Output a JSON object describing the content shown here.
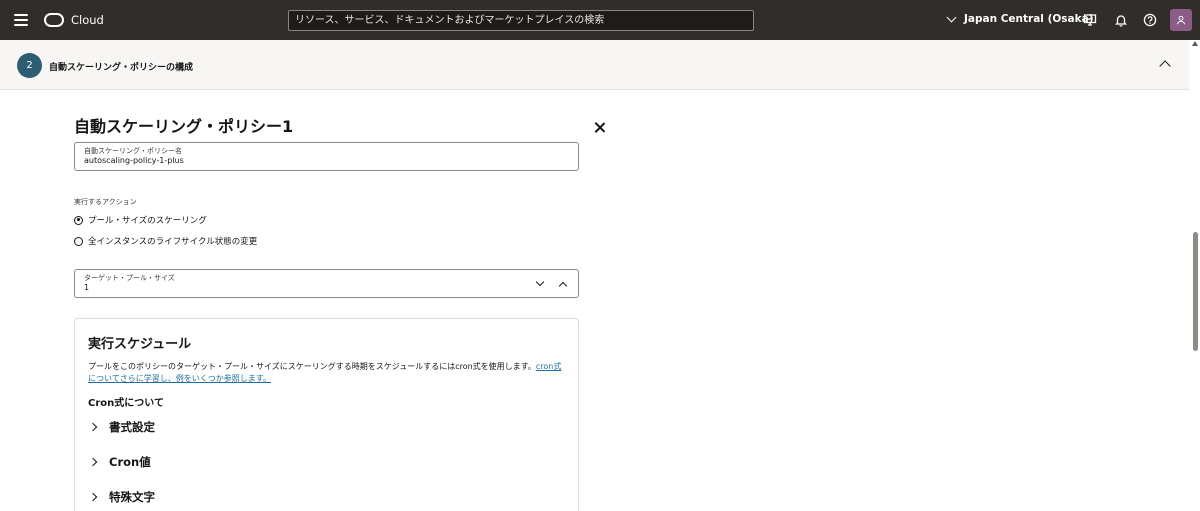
{
  "topbar": {
    "brand": "Cloud",
    "search_placeholder": "リソース、サービス、ドキュメントおよびマーケットプレイスの検索",
    "region": "Japan Central (Osaka)",
    "icons": [
      "menu-icon",
      "oracle-logo",
      "chevron-down-icon",
      "developer-tools-icon",
      "bell-icon",
      "help-icon",
      "user-icon"
    ]
  },
  "step": {
    "number": "2",
    "title": "自動スケーリング・ポリシーの構成"
  },
  "policy": {
    "title": "自動スケーリング・ポリシー1",
    "name_label": "自動スケーリング・ポリシー名",
    "name_value": "autoscaling-policy-1-plus",
    "action_label": "実行するアクション",
    "actions": [
      {
        "label": "プール・サイズのスケーリング",
        "selected": true
      },
      {
        "label": "全インスタンスのライフサイクル状態の変更",
        "selected": false
      }
    ],
    "target_label": "ターゲット・プール・サイズ",
    "target_value": "1"
  },
  "schedule": {
    "title": "実行スケジュール",
    "description": "プールをこのポリシーのターゲット・プール・サイズにスケーリングする時期をスケジュールするにはcron式を使用します。",
    "link": "cron式についてさらに学習し、例をいくつか参照します。",
    "cron_about": "Cron式について",
    "accordions": [
      "書式設定",
      "Cron値",
      "特殊文字"
    ]
  }
}
